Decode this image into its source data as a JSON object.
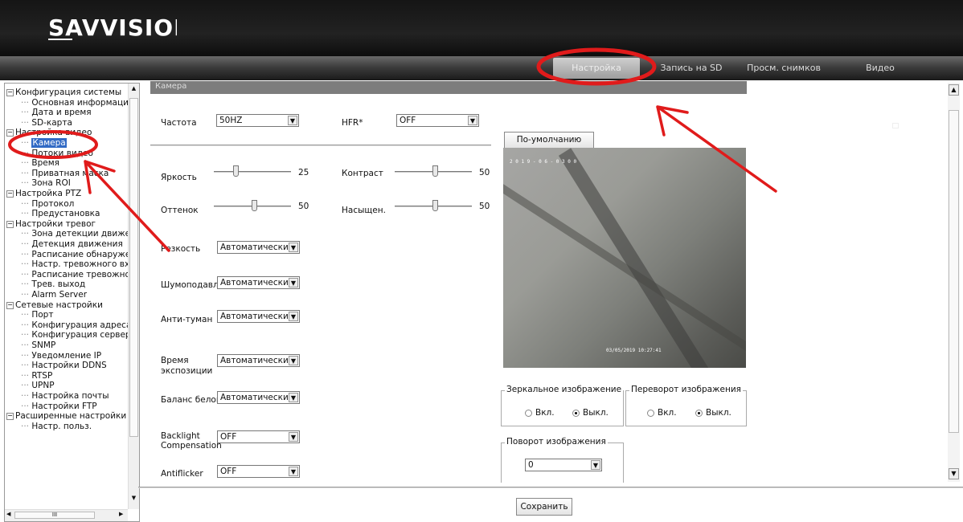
{
  "brand": {
    "logo_text": "SAVVISION"
  },
  "nav": {
    "items": [
      {
        "label": "Настройка",
        "active": true
      },
      {
        "label": "Запись на SD",
        "active": false
      },
      {
        "label": "Просм. снимков",
        "active": false
      },
      {
        "label": "Видео",
        "active": false
      }
    ]
  },
  "tree": {
    "items": [
      {
        "label": "Конфигурация системы",
        "level": 0,
        "box": "minus"
      },
      {
        "label": "Основная информация",
        "level": 1
      },
      {
        "label": "Дата и время",
        "level": 1
      },
      {
        "label": "SD-карта",
        "level": 1
      },
      {
        "label": "Настройка видео",
        "level": 0,
        "box": "minus"
      },
      {
        "label": "Камера",
        "level": 1,
        "selected": true
      },
      {
        "label": "Потоки видео",
        "level": 1
      },
      {
        "label": "Время",
        "level": 1
      },
      {
        "label": "Приватная маска",
        "level": 1
      },
      {
        "label": "Зона ROI",
        "level": 1
      },
      {
        "label": "Настройка PTZ",
        "level": 0,
        "box": "minus"
      },
      {
        "label": "Протокол",
        "level": 1
      },
      {
        "label": "Предустановка",
        "level": 1
      },
      {
        "label": "Настройки тревог",
        "level": 0,
        "box": "minus"
      },
      {
        "label": "Зона детекции движения",
        "level": 1
      },
      {
        "label": "Детекция движения",
        "level": 1
      },
      {
        "label": "Расписание обнаружения",
        "level": 1
      },
      {
        "label": "Настр. тревожного входа",
        "level": 1
      },
      {
        "label": "Расписание тревожного",
        "level": 1
      },
      {
        "label": "Трев. выход",
        "level": 1
      },
      {
        "label": "Alarm Server",
        "level": 1
      },
      {
        "label": "Сетевые настройки",
        "level": 0,
        "box": "minus"
      },
      {
        "label": "Порт",
        "level": 1
      },
      {
        "label": "Конфигурация адреса IP",
        "level": 1
      },
      {
        "label": "Конфигурация сервера",
        "level": 1
      },
      {
        "label": "SNMP",
        "level": 1
      },
      {
        "label": "Уведомление IP",
        "level": 1
      },
      {
        "label": "Настройки DDNS",
        "level": 1
      },
      {
        "label": "RTSP",
        "level": 1
      },
      {
        "label": "UPNP",
        "level": 1
      },
      {
        "label": "Настройка почты",
        "level": 1
      },
      {
        "label": "Настройки FTP",
        "level": 1
      },
      {
        "label": "Расширенные настройки",
        "level": 0,
        "box": "minus"
      },
      {
        "label": "Настр. польз.",
        "level": 1
      }
    ]
  },
  "panel": {
    "title": "Камера",
    "frequency": {
      "label": "Частота",
      "value": "50HZ"
    },
    "hfr": {
      "label": "HFR*",
      "value": "OFF"
    },
    "brightness": {
      "label": "Яркость",
      "value": 25
    },
    "contrast": {
      "label": "Контраст",
      "value": 50
    },
    "hue": {
      "label": "Оттенок",
      "value": 50
    },
    "saturation": {
      "label": "Насыщен.",
      "value": 50
    },
    "sharpness": {
      "label": "Резкость",
      "value": "Автоматически"
    },
    "noise": {
      "label": "Шумоподавл.",
      "value": "Автоматически"
    },
    "antifog": {
      "label": "Анти-туман",
      "value": "Автоматически"
    },
    "exposure": {
      "label_line1": "Время",
      "label_line2": "экспозиции",
      "value": "Автоматически"
    },
    "white_balance": {
      "label": "Баланс белого",
      "value": "Автоматически"
    },
    "backlight": {
      "label_line1": "Backlight",
      "label_line2": "Compensation",
      "value": "OFF"
    },
    "antiflicker": {
      "label": "Antiflicker",
      "value": "OFF"
    },
    "default_button": "По-умолчанию",
    "preview": {
      "osd_top": "2 0 1 9 - 0 6 - 0 3 0 0",
      "osd_bottom": "03/05/2019 10:27:41"
    },
    "mirror": {
      "title": "Зеркальное изображение",
      "on": "Вкл.",
      "off": "Выкл.",
      "selected": "off"
    },
    "flip": {
      "title": "Переворот изображения",
      "on": "Вкл.",
      "off": "Выкл.",
      "selected": "off"
    },
    "rotation": {
      "title": "Поворот изображения",
      "value": "0"
    },
    "save_button": "Сохранить"
  },
  "colors": {
    "annotation": "#e01b1b",
    "selection": "#316ac5",
    "title_bar": "#7d7d7d"
  }
}
